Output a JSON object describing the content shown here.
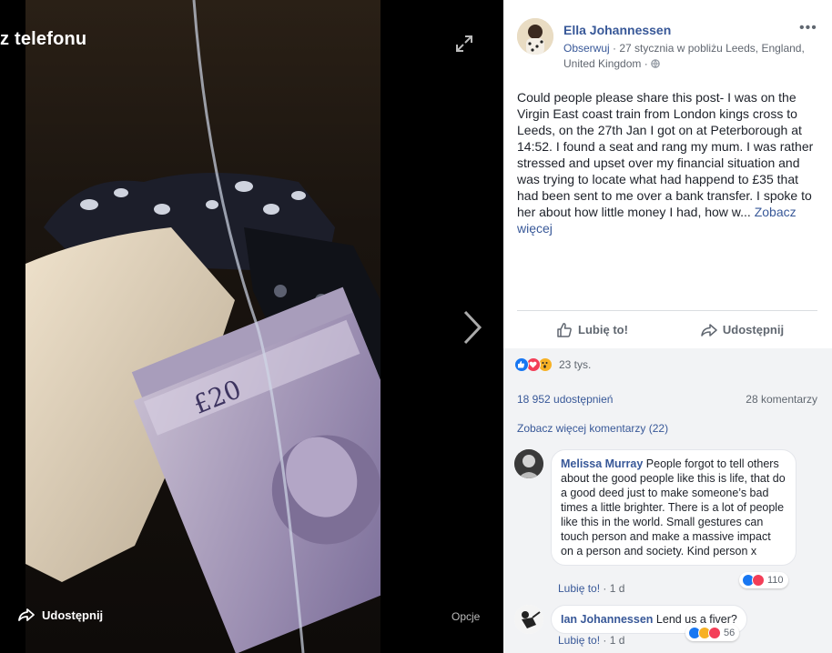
{
  "viewer": {
    "title": "z telefonu",
    "share_label": "Udostępnij",
    "options_label": "Opcje",
    "expand_icon": "expand-icon",
    "next_icon": "chevron-right-icon"
  },
  "post": {
    "author": "Ella Johannessen",
    "follow_label": "Obserwuj",
    "meta_text": " · 27 stycznia w pobliżu Leeds, England, United Kingdom · ",
    "body": "Could people please share this post- I was on the Virgin East coast train from London kings cross to Leeds, on the 27th Jan I got on at Peterborough at 14:52. I found a seat and rang my mum. I was rather stressed and upset over my financial situation and was trying to locate what had happend to £35 that had been sent to me over a bank transfer. I spoke to her about how little money I had, how w... ",
    "see_more": "Zobacz więcej"
  },
  "actions": {
    "like_label": "Lubię to!",
    "share_label": "Udostępnij"
  },
  "stats": {
    "reactions_count": "23 tys.",
    "shares": "18 952 udostępnień",
    "comments": "28 komentarzy",
    "more_comments": "Zobacz więcej komentarzy (22)"
  },
  "comments": [
    {
      "name": "Melissa Murray",
      "text": " People forgot to tell others about the good people like this is life, that do a good deed just to make someone’s bad times a little brighter. There is a lot of people like this in the world. Small gestures can touch person and make a massive impact on a person and society. Kind person x",
      "like_label": "Lubię to!",
      "time": " · 1 d",
      "reaction_count": "110"
    },
    {
      "name": "Ian Johannessen",
      "text": " Lend us a fiver?",
      "like_label": "Lubię to!",
      "time": " · 1 d",
      "reaction_count": "56"
    }
  ],
  "colors": {
    "link": "#385898",
    "like_blue": "#1877f2",
    "love_red": "#f33e58",
    "wow_yellow": "#f7b125"
  }
}
